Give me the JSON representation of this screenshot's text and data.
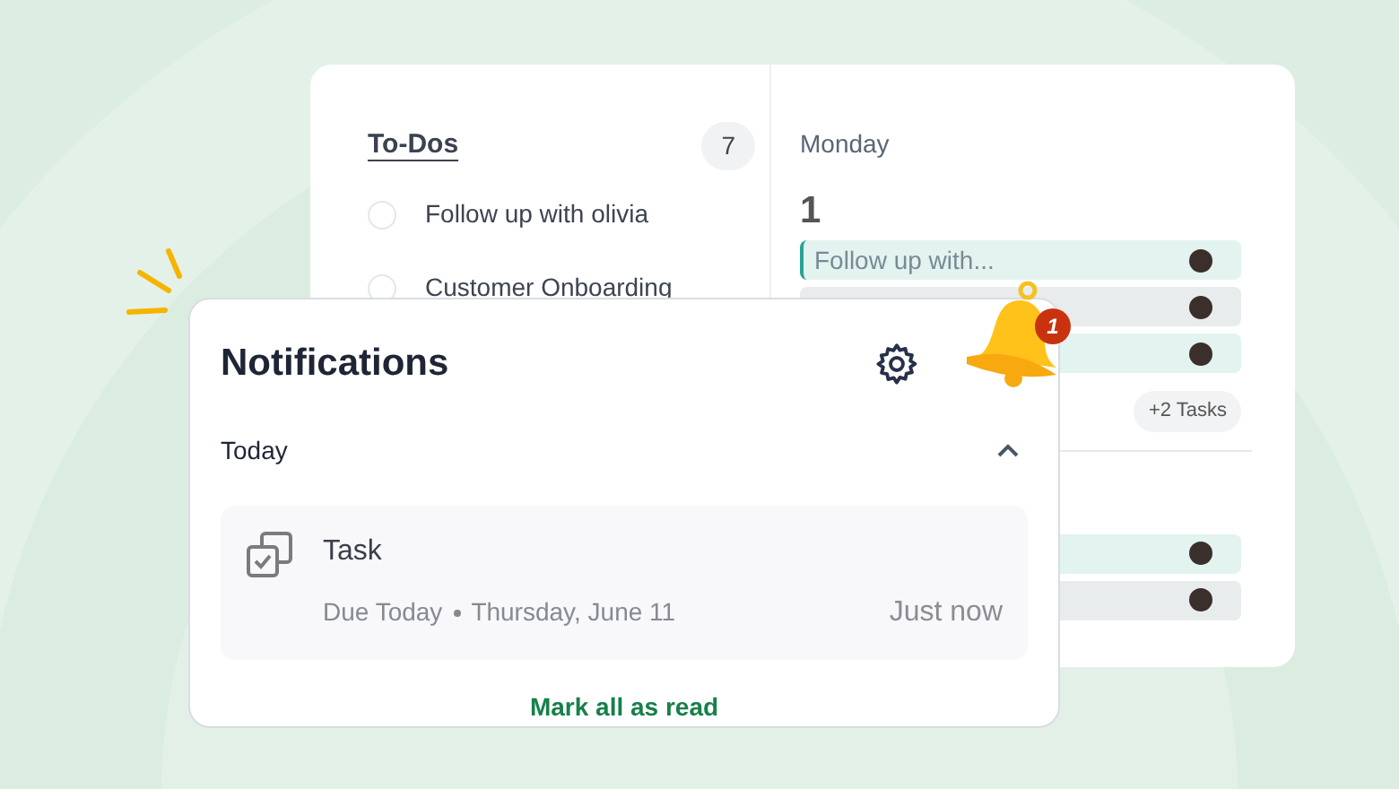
{
  "todos": {
    "title": "To-Dos",
    "count": "7",
    "items": [
      {
        "label": "Follow up with olivia",
        "checked": false
      },
      {
        "label": "Customer Onboarding",
        "checked": false
      }
    ]
  },
  "calendar": {
    "day": "Monday",
    "date": "1",
    "groups": [
      {
        "events": [
          {
            "label": "Follow up with...",
            "color": "#e2f3f0"
          },
          {
            "color": "#e9ecec"
          },
          {
            "color": "#e2f3f0"
          }
        ],
        "more": "+2 Tasks"
      },
      {
        "events": [
          {
            "color": "#e2f3f0"
          },
          {
            "color": "#e9ecec"
          }
        ]
      }
    ]
  },
  "bell": {
    "badge": "1"
  },
  "notifications": {
    "title": "Notifications",
    "section": {
      "label": "Today",
      "expanded": true
    },
    "items": [
      {
        "title": "Task",
        "due": "Due Today",
        "date": "Thursday, June 11",
        "time": "Just now"
      }
    ],
    "action": "Mark all as read"
  }
}
